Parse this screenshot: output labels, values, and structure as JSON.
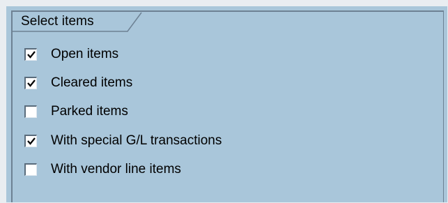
{
  "group": {
    "title": "Select items"
  },
  "checkboxes": [
    {
      "label": "Open items",
      "checked": true
    },
    {
      "label": "Cleared items",
      "checked": true
    },
    {
      "label": "Parked items",
      "checked": false
    },
    {
      "label": "With special G/L transactions",
      "checked": true
    },
    {
      "label": "With vendor line items",
      "checked": false
    }
  ],
  "colors": {
    "panel_background": "#a9c6da",
    "border": "#6d8193",
    "outer_frame": "#e9edf1"
  }
}
